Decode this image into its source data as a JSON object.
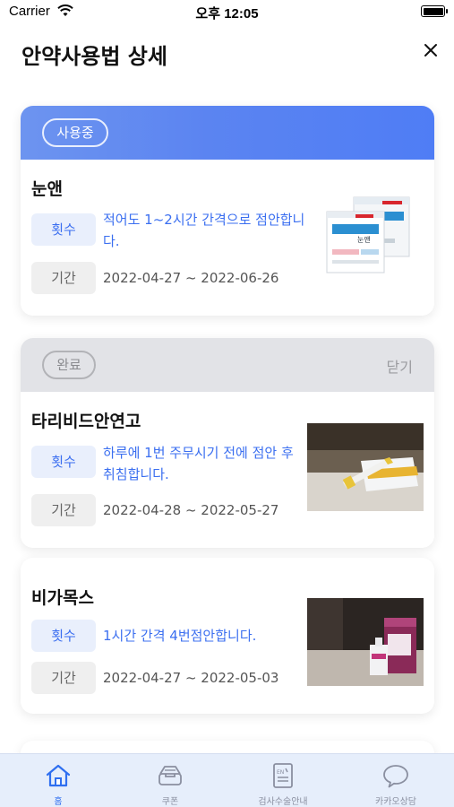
{
  "status_bar": {
    "carrier": "Carrier",
    "time": "오후 12:05"
  },
  "header": {
    "title": "안약사용법 상세"
  },
  "groups": [
    {
      "status": "사용중",
      "items": [
        {
          "name": "눈앤",
          "frequency_label": "횟수",
          "frequency_line1": "적어도 1~2시간 간격으로 점안합니",
          "frequency_line2": "다.",
          "period_label": "기간",
          "period": "2022-04-27 ~ 2022-06-26"
        }
      ]
    },
    {
      "status": "완료",
      "close_label": "닫기",
      "items": [
        {
          "name": "타리비드안연고",
          "frequency_label": "횟수",
          "frequency_line1": "하루에 1번 주무시기 전에 점안 후",
          "frequency_line2": "취침합니다.",
          "period_label": "기간",
          "period": "2022-04-28 ~ 2022-05-27"
        },
        {
          "name": "비가목스",
          "frequency_label": "횟수",
          "frequency_line1": "1시간 간격 4번점안합니다.",
          "period_label": "기간",
          "period": "2022-04-27 ~ 2022-05-03"
        }
      ]
    }
  ],
  "tabbar": {
    "tabs": [
      {
        "label": "홈",
        "icon": "home-icon",
        "active": true
      },
      {
        "label": "쿠폰",
        "icon": "coupon-tray-icon",
        "active": false
      },
      {
        "label": "검사수술안내",
        "icon": "guide-document-icon",
        "active": false
      },
      {
        "label": "카카오상담",
        "icon": "chat-bubble-icon",
        "active": false
      }
    ]
  },
  "colors": {
    "accent": "#3b6ff0",
    "active_header": "#5b84f1",
    "done_header": "#e2e3e7",
    "tabbar_bg": "#e6eefb"
  }
}
